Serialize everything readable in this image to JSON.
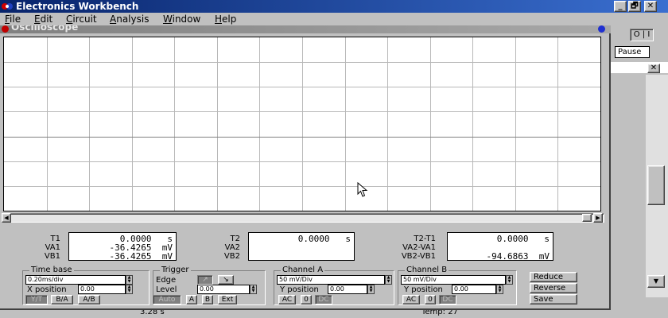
{
  "window": {
    "title": "Electronics Workbench"
  },
  "window_controls": {
    "minimize": "_",
    "maximize": "🗗",
    "close": "✕"
  },
  "menu": {
    "items": [
      {
        "label": "File",
        "key": "F",
        "rest": "ile"
      },
      {
        "label": "Edit",
        "key": "E",
        "rest": "dit"
      },
      {
        "label": "Circuit",
        "key": "C",
        "rest": "ircuit"
      },
      {
        "label": "Analysis",
        "key": "A",
        "rest": "nalysis"
      },
      {
        "label": "Window",
        "key": "W",
        "rest": "indow"
      },
      {
        "label": "Help",
        "key": "H",
        "rest": "elp"
      }
    ]
  },
  "background": {
    "toolbar_switch": "O | I",
    "pause_label": "Pause",
    "close_glyph": "✕",
    "scroll_down_glyph": "▼",
    "status_left": "3.28 s",
    "status_temp": "Temp:  27"
  },
  "scope": {
    "title": "Oscilloscope",
    "marker_1": "1",
    "marker_2": "2",
    "scroll_left_glyph": "◀",
    "scroll_right_glyph": "▶",
    "readouts": {
      "t1": {
        "labels": [
          "T1",
          "VA1",
          "VB1"
        ],
        "lines": [
          "0.0000   s",
          "-36.4265  mV",
          "-36.4265  mV"
        ]
      },
      "t2": {
        "labels": [
          "T2",
          "VA2",
          "VB2"
        ],
        "lines": [
          "0.0000   s",
          "",
          ""
        ]
      },
      "delta": {
        "labels": [
          "T2-T1",
          "VA2-VA1",
          "VB2-VB1"
        ],
        "lines": [
          "0.0000   s",
          "",
          "-94.6863  mV"
        ]
      }
    },
    "timebase": {
      "title": "Time base",
      "value": "0.20ms/div",
      "xpos_label": "X position",
      "xpos_value": "0.00",
      "buttons": [
        "Y/T",
        "B/A",
        "A/B"
      ]
    },
    "trigger": {
      "title": "Trigger",
      "edge_label": "Edge",
      "edge_buttons": [
        "↗",
        "↘"
      ],
      "level_label": "Level",
      "level_value": "0.00",
      "buttons": [
        "Auto",
        "A",
        "B",
        "Ext"
      ]
    },
    "channel_a": {
      "title": "Channel A",
      "value": "50 mV/Div",
      "ypos_label": "Y position",
      "ypos_value": "0.00",
      "buttons": [
        "AC",
        "0",
        "DC"
      ]
    },
    "channel_b": {
      "title": "Channel B",
      "value": "50 mV/Div",
      "ypos_label": "Y position",
      "ypos_value": "0.00",
      "buttons": [
        "AC",
        "0",
        "DC"
      ]
    },
    "side_buttons": [
      "Reduce",
      "Reverse",
      "Save"
    ],
    "grid": {
      "vertical_divisions": 14,
      "horizontal_divisions": 7,
      "grid_color": "#b8b8b8",
      "axis_color": "#808080"
    }
  }
}
